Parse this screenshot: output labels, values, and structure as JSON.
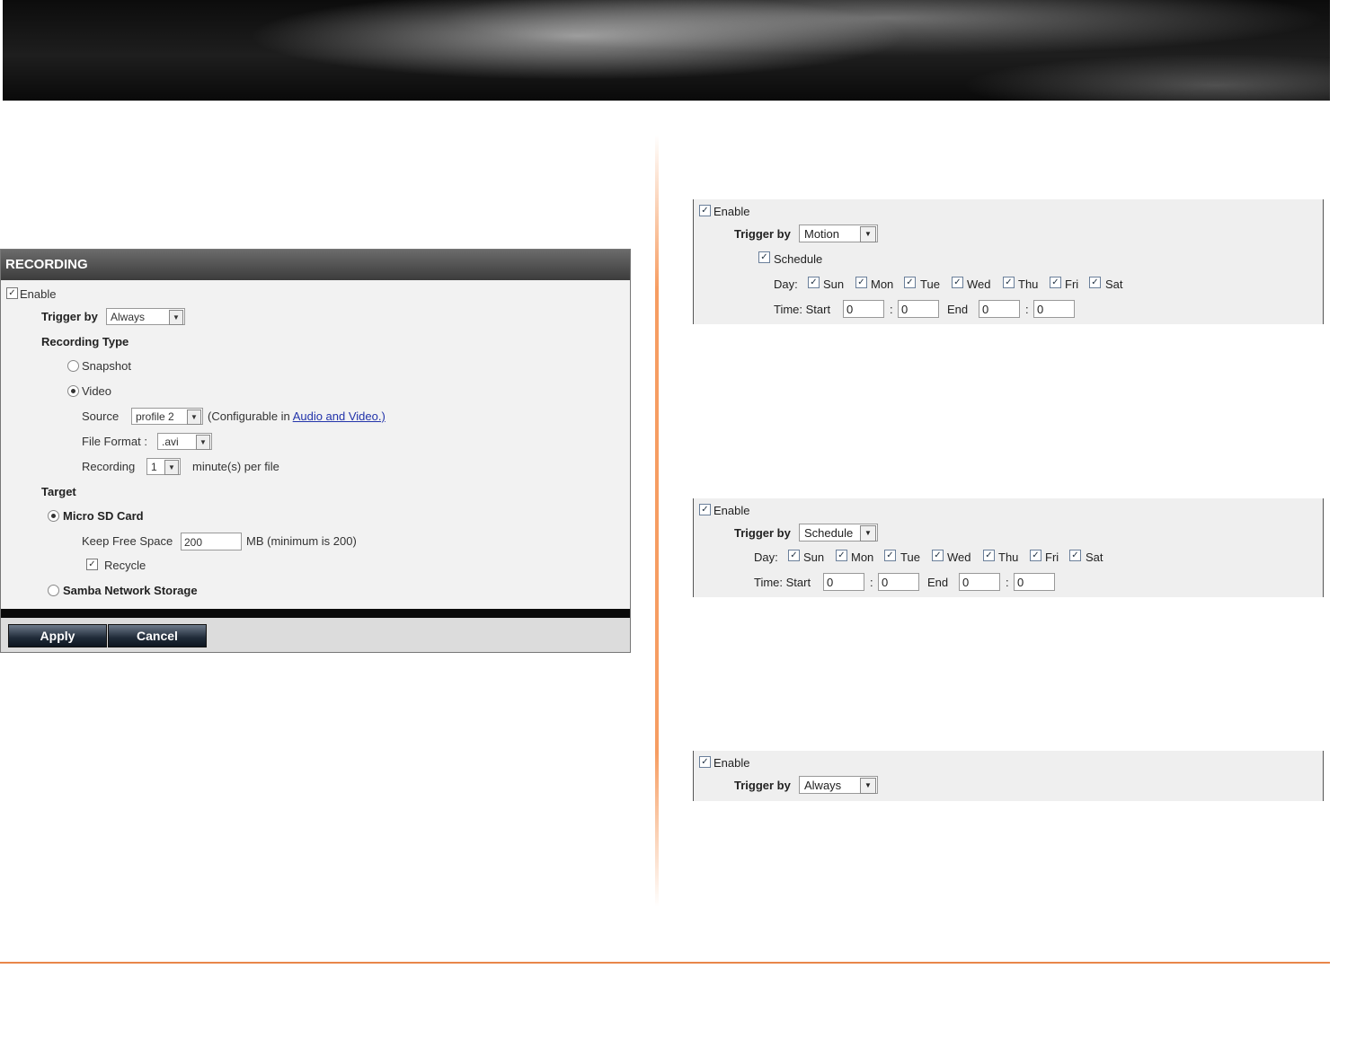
{
  "recording": {
    "title": "RECORDING",
    "enable_label": "Enable",
    "trigger_label": "Trigger by",
    "trigger_value": "Always",
    "recording_type_label": "Recording Type",
    "snapshot_label": "Snapshot",
    "video_label": "Video",
    "source_label": "Source",
    "source_value": "profile 2",
    "source_note_prefix": "(Configurable in",
    "source_note_link": "Audio and Video.)",
    "file_format_label": "File Format :",
    "file_format_value": ".avi",
    "recording_label": "Recording",
    "recording_value": "1",
    "recording_suffix": "minute(s) per file",
    "target_label": "Target",
    "micro_sd_label": "Micro SD Card",
    "keep_free_label": "Keep Free Space",
    "keep_free_value": "200",
    "keep_free_suffix": "MB (minimum is 200)",
    "recycle_label": "Recycle",
    "samba_label": "Samba Network Storage",
    "apply_label": "Apply",
    "cancel_label": "Cancel"
  },
  "motion_panel": {
    "enable_label": "Enable",
    "trigger_label": "Trigger by",
    "trigger_value": "Motion",
    "schedule_label": "Schedule",
    "day_label": "Day:",
    "days": [
      "Sun",
      "Mon",
      "Tue",
      "Wed",
      "Thu",
      "Fri",
      "Sat"
    ],
    "time_start_label": "Time: Start",
    "start_h": "0",
    "start_m": "0",
    "end_label": "End",
    "end_h": "0",
    "end_m": "0",
    "colon": ":"
  },
  "schedule_panel": {
    "enable_label": "Enable",
    "trigger_label": "Trigger by",
    "trigger_value": "Schedule",
    "day_label": "Day:",
    "days": [
      "Sun",
      "Mon",
      "Tue",
      "Wed",
      "Thu",
      "Fri",
      "Sat"
    ],
    "time_start_label": "Time: Start",
    "start_h": "0",
    "start_m": "0",
    "end_label": "End",
    "end_h": "0",
    "end_m": "0",
    "colon": ":"
  },
  "always_panel": {
    "enable_label": "Enable",
    "trigger_label": "Trigger by",
    "trigger_value": "Always"
  },
  "icons": {
    "check": "✓",
    "dropdown_arrow": "▼"
  }
}
